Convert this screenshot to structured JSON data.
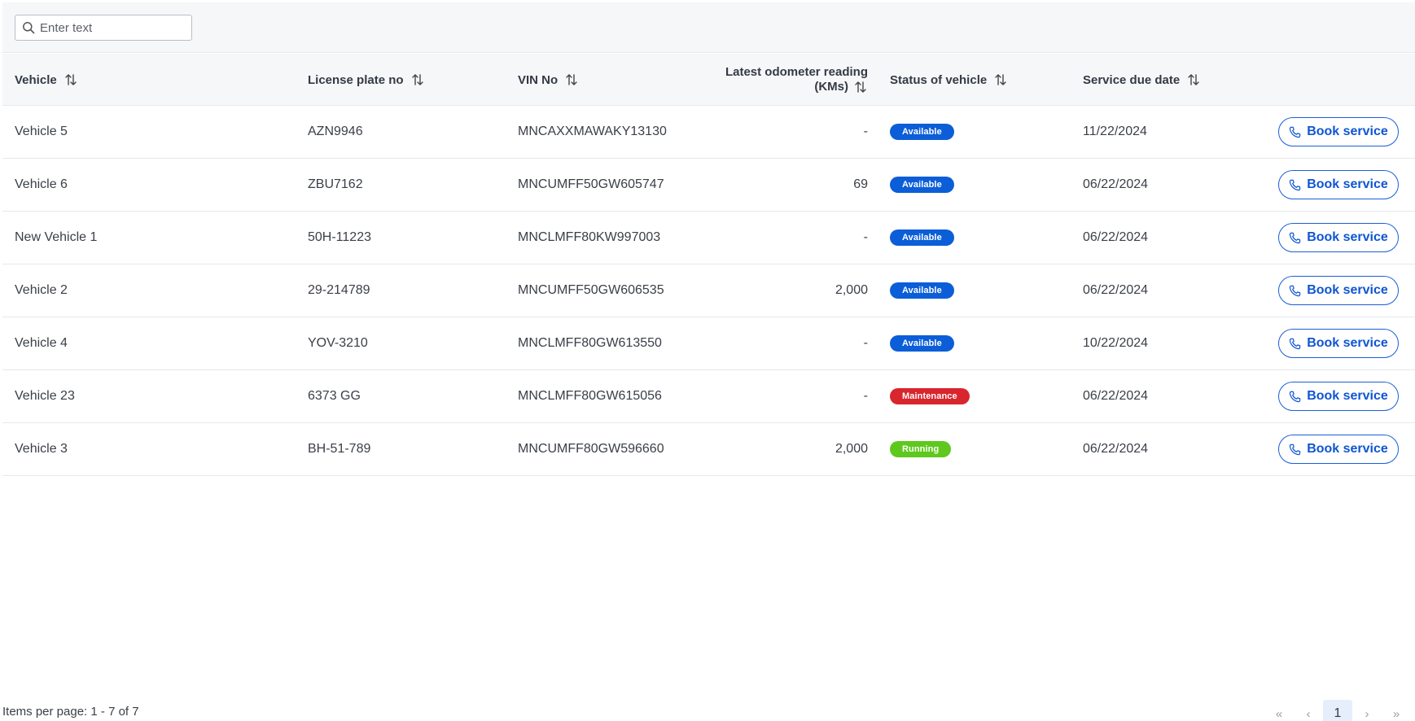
{
  "search": {
    "placeholder": "Enter text"
  },
  "columns": {
    "vehicle": "Vehicle",
    "plate": "License plate no",
    "vin": "VIN No",
    "odo_line1": "Latest odometer reading",
    "odo_line2": "(KMs)",
    "status": "Status of vehicle",
    "due": "Service due date"
  },
  "rows": [
    {
      "vehicle": "Vehicle 5",
      "plate": "AZN9946",
      "vin": "MNCAXXMAWAKY13130",
      "odo": "-",
      "status": "Available",
      "due": "11/22/2024",
      "action": "Book service"
    },
    {
      "vehicle": "Vehicle 6",
      "plate": "ZBU7162",
      "vin": "MNCUMFF50GW605747",
      "odo": "69",
      "status": "Available",
      "due": "06/22/2024",
      "action": "Book service"
    },
    {
      "vehicle": "New Vehicle 1",
      "plate": "50H-11223",
      "vin": "MNCLMFF80KW997003",
      "odo": "-",
      "status": "Available",
      "due": "06/22/2024",
      "action": "Book service"
    },
    {
      "vehicle": "Vehicle 2",
      "plate": "29-214789",
      "vin": "MNCUMFF50GW606535",
      "odo": "2,000",
      "status": "Available",
      "due": "06/22/2024",
      "action": "Book service"
    },
    {
      "vehicle": "Vehicle 4",
      "plate": "YOV-3210",
      "vin": "MNCLMFF80GW613550",
      "odo": "-",
      "status": "Available",
      "due": "10/22/2024",
      "action": "Book service"
    },
    {
      "vehicle": "Vehicle 23",
      "plate": "6373 GG",
      "vin": "MNCLMFF80GW615056",
      "odo": "-",
      "status": "Maintenance",
      "due": "06/22/2024",
      "action": "Book service"
    },
    {
      "vehicle": "Vehicle 3",
      "plate": "BH-51-789",
      "vin": "MNCUMFF80GW596660",
      "odo": "2,000",
      "status": "Running",
      "due": "06/22/2024",
      "action": "Book service"
    }
  ],
  "status_colors": {
    "Available": "#0b5ed7",
    "Maintenance": "#d9252d",
    "Running": "#5ec81e"
  },
  "footer": {
    "items_per_page": "Items per page: 1 - 7 of 7"
  },
  "pagination": {
    "first": "«",
    "prev": "‹",
    "current": "1",
    "next": "›",
    "last": "»"
  },
  "icons": {
    "search": "search-icon",
    "sort": "sort-icon",
    "phone": "phone-icon"
  }
}
